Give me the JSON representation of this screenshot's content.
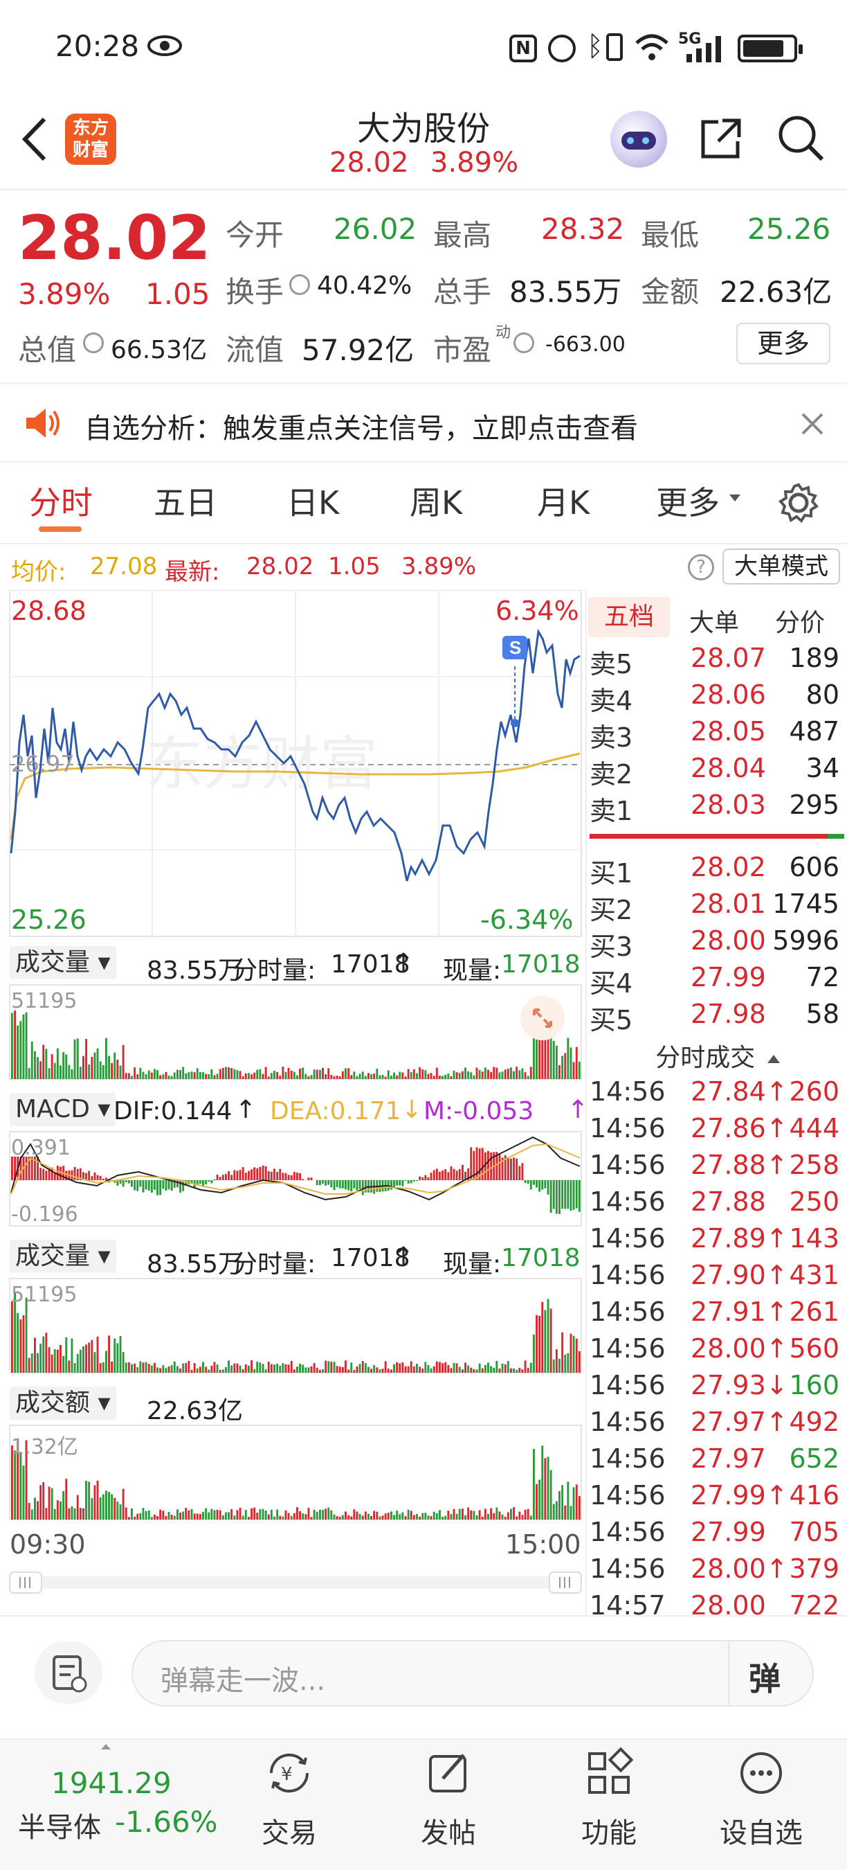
{
  "status_bar": {
    "time": "20:28",
    "network": "5G"
  },
  "header": {
    "title": "大为股份",
    "price": "28.02",
    "pct": "3.89%",
    "logo_line1": "东方",
    "logo_line2": "财富"
  },
  "quote": {
    "price": "28.02",
    "pct": "3.89%",
    "change": "1.05",
    "open_label": "今开",
    "open": "26.02",
    "high_label": "最高",
    "high": "28.32",
    "low_label": "最低",
    "low": "25.26",
    "turnover_label": "换手",
    "turnover": "40.42%",
    "volume_label": "总手",
    "volume": "83.55万",
    "amount_label": "金额",
    "amount": "22.63亿",
    "mktcap_label": "总值",
    "mktcap": "66.53亿",
    "float_label": "流值",
    "float": "57.92亿",
    "pe_label": "市盈",
    "pe_sup": "动",
    "pe": "-663.00",
    "more_button": "更多"
  },
  "banner": {
    "text": "自选分析：触发重点关注信号，立即点击查看"
  },
  "tabs": [
    "分时",
    "五日",
    "日K",
    "周K",
    "月K",
    "更多"
  ],
  "info_line": {
    "avg_label": "均价:",
    "avg": "27.08",
    "latest_label": "最新:",
    "latest": "28.02",
    "change": "1.05",
    "pct": "3.89%",
    "mode_button": "大单模式"
  },
  "chart": {
    "top_price": "28.68",
    "top_pct": "6.34%",
    "bottom_price": "25.26",
    "bottom_pct": "-6.34%",
    "mid_price": "26.97",
    "watermark": "东方财富",
    "marker": "S",
    "vol_label": "成交量",
    "vol_value": "83.55万",
    "fs_label": "分时量:",
    "fs_value": "17018",
    "now_label": "现量:",
    "now_value": "17018",
    "vol_max": "51195",
    "macd_label": "MACD",
    "dif": "DIF:0.144",
    "dea": "DEA:0.171",
    "m": "M:-0.053",
    "macd_top": "0.391",
    "macd_bottom": "-0.196",
    "vol2_label": "成交量",
    "vol2_value": "83.55万",
    "fs2_label": "分时量:",
    "fs2_value": "17018",
    "now2_label": "现量:",
    "now2_value": "17018",
    "vol2_max": "51195",
    "amt_label": "成交额",
    "amt_value": "22.63亿",
    "amt_max": "1.32亿",
    "time_start": "09:30",
    "time_end": "15:00"
  },
  "orderbook": {
    "tabs": [
      "五档",
      "大单",
      "分价"
    ],
    "sells": [
      {
        "label": "卖5",
        "price": "28.07",
        "qty": "189"
      },
      {
        "label": "卖4",
        "price": "28.06",
        "qty": "80"
      },
      {
        "label": "卖3",
        "price": "28.05",
        "qty": "487"
      },
      {
        "label": "卖2",
        "price": "28.04",
        "qty": "34"
      },
      {
        "label": "卖1",
        "price": "28.03",
        "qty": "295"
      }
    ],
    "buys": [
      {
        "label": "买1",
        "price": "28.02",
        "qty": "606"
      },
      {
        "label": "买2",
        "price": "28.01",
        "qty": "1745"
      },
      {
        "label": "买3",
        "price": "28.00",
        "qty": "5996"
      },
      {
        "label": "买4",
        "price": "27.99",
        "qty": "72"
      },
      {
        "label": "买5",
        "price": "27.98",
        "qty": "58"
      }
    ]
  },
  "ticks": {
    "title": "分时成交",
    "rows": [
      {
        "time": "14:56",
        "price": "27.84↑",
        "qty": "260",
        "dir": "up"
      },
      {
        "time": "14:56",
        "price": "27.86↑",
        "qty": "444",
        "dir": "up"
      },
      {
        "time": "14:56",
        "price": "27.88↑",
        "qty": "258",
        "dir": "up"
      },
      {
        "time": "14:56",
        "price": "27.88",
        "qty": "250",
        "dir": "up"
      },
      {
        "time": "14:56",
        "price": "27.89↑",
        "qty": "143",
        "dir": "up"
      },
      {
        "time": "14:56",
        "price": "27.90↑",
        "qty": "431",
        "dir": "up"
      },
      {
        "time": "14:56",
        "price": "27.91↑",
        "qty": "261",
        "dir": "up"
      },
      {
        "time": "14:56",
        "price": "28.00↑",
        "qty": "560",
        "dir": "up"
      },
      {
        "time": "14:56",
        "price": "27.93↓",
        "qty": "160",
        "dir": "down"
      },
      {
        "time": "14:56",
        "price": "27.97↑",
        "qty": "492",
        "dir": "up"
      },
      {
        "time": "14:56",
        "price": "27.97",
        "qty": "652",
        "dir": "green"
      },
      {
        "time": "14:56",
        "price": "27.99↑",
        "qty": "416",
        "dir": "up"
      },
      {
        "time": "14:56",
        "price": "27.99",
        "qty": "705",
        "dir": "up"
      },
      {
        "time": "14:56",
        "price": "28.00↑",
        "qty": "379",
        "dir": "up"
      },
      {
        "time": "14:57",
        "price": "28.00",
        "qty": "722",
        "dir": "up"
      }
    ]
  },
  "comment": {
    "placeholder": "弹幕走一波...",
    "danmu": "弹"
  },
  "bottom_nav": {
    "index_value": "1941.29",
    "index_name": "半导体",
    "index_pct": "-1.66%",
    "items": [
      "交易",
      "发帖",
      "功能",
      "设自选"
    ]
  },
  "colors": {
    "up": "#d8282f",
    "down": "#2a9a3a",
    "price_line": "#2e5aa8",
    "avg_line": "#e8b540",
    "accent": "#d8282f"
  }
}
